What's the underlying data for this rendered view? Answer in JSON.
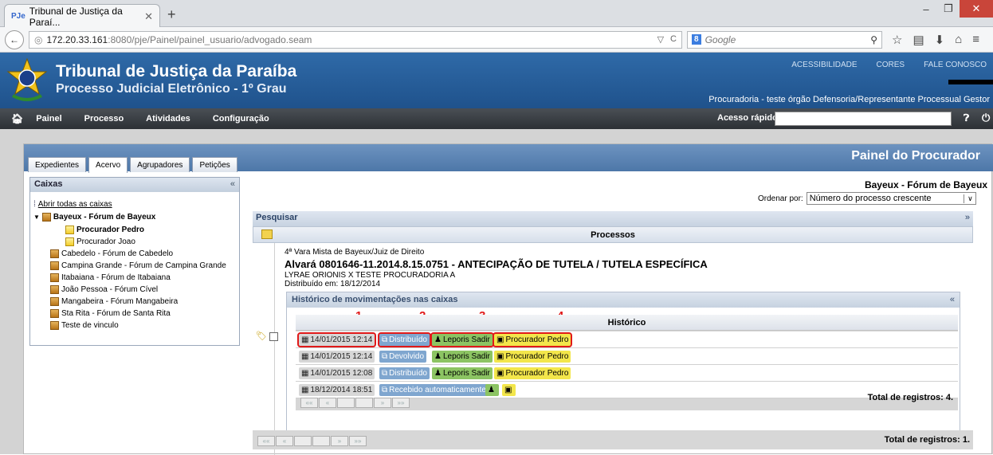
{
  "browser": {
    "tab_title": "Tribunal de Justiça da Paraí...",
    "tab_favicon": "PJe",
    "url_host": "172.20.33.161",
    "url_rest": ":8080/pje/Painel/painel_usuario/advogado.seam",
    "search_placeholder": "Google",
    "search_engine": "8"
  },
  "header": {
    "title": "Tribunal de Justiça da Paraíba",
    "subtitle": "Processo Judicial Eletrônico - 1º Grau",
    "links": [
      "ACESSIBILIDADE",
      "CORES",
      "FALE CONOSCO"
    ],
    "user_line": "Procuradoria - teste órgão Defensoria/Representante Processual Gestor"
  },
  "menu": {
    "items": [
      "Painel",
      "Processo",
      "Atividades",
      "Configuração"
    ],
    "quick_access_label": "Acesso rápido:"
  },
  "panel": {
    "title": "Painel do Procurador",
    "tabs": [
      "Expedientes",
      "Acervo",
      "Agrupadores",
      "Petições"
    ],
    "active_tab": "Acervo"
  },
  "caixas": {
    "header": "Caixas",
    "open_all": "Abrir todas as caixas",
    "tree": [
      {
        "label": "Bayeux - Fórum de Bayeux",
        "bold": true
      },
      {
        "label": "Procurador Pedro",
        "bold": true
      },
      {
        "label": "Procurador Joao",
        "bold": false
      },
      {
        "label": "Cabedelo - Fórum de Cabedelo",
        "bold": false
      },
      {
        "label": "Campina Grande - Fórum de Campina Grande",
        "bold": false
      },
      {
        "label": "Itabaiana - Fórum de Itabaiana",
        "bold": false
      },
      {
        "label": "João Pessoa - Fórum Cível",
        "bold": false
      },
      {
        "label": "Mangabeira - Fórum Mangabeira",
        "bold": false
      },
      {
        "label": "Sta Rita - Fórum de Santa Rita",
        "bold": false
      },
      {
        "label": "Teste de vinculo",
        "bold": false
      }
    ]
  },
  "main": {
    "forum_title": "Bayeux - Fórum de Bayeux",
    "order_label": "Ordenar por:",
    "order_value": "Número do processo crescente",
    "search_header": "Pesquisar",
    "processes_header": "Processos",
    "process": {
      "court": "4ª Vara Mista de Bayeux/Juiz de Direito",
      "title": "Alvará 0801646-11.2014.8.15.0751 - ANTECIPAÇÃO DE TUTELA / TUTELA ESPECÍFICA",
      "parties": "LYRAE ORIONIS X TESTE PROCURADORIA A",
      "distributed": "Distribuído em: 18/12/2014"
    },
    "history": {
      "header": "Histórico de movimentações nas caixas",
      "column": "Histórico",
      "annotations": [
        "1",
        "2",
        "3",
        "4"
      ],
      "rows": [
        {
          "date": "14/01/2015 12:14",
          "status": "Distribuído",
          "user": "Leporis Sadir",
          "box": "Procurador Pedro"
        },
        {
          "date": "14/01/2015 12:14",
          "status": "Devolvido",
          "user": "Leporis Sadir",
          "box": "Procurador Pedro"
        },
        {
          "date": "14/01/2015 12:08",
          "status": "Distribuído",
          "user": "Leporis Sadir",
          "box": "Procurador Pedro"
        },
        {
          "date": "18/12/2014 18:51",
          "status": "Recebido automaticamente",
          "user": "",
          "box": ""
        }
      ],
      "total": "Total de registros: 4."
    },
    "total": "Total de registros: 1.",
    "pager": [
      "««",
      "«",
      "",
      "",
      "»",
      "»»"
    ]
  },
  "colors": {
    "header_blue": "#2f6aa8",
    "status_chip": "#7fa6cf",
    "user_chip": "#8cc463",
    "box_chip": "#f3e64b",
    "annotation_red": "#e01919"
  }
}
